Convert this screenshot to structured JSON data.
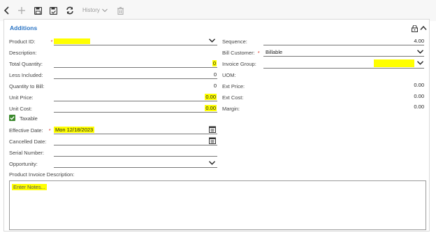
{
  "toolbar": {
    "history_label": "History"
  },
  "section": {
    "title": "Additions"
  },
  "left": {
    "product_id_label": "Product ID:",
    "description_label": "Description:",
    "total_quantity_label": "Total Quantity:",
    "total_quantity_value": "0",
    "less_included_label": "Less Included:",
    "less_included_value": "0",
    "quantity_to_bill_label": "Quantity to Bill:",
    "quantity_to_bill_value": "0",
    "unit_price_label": "Unit Price:",
    "unit_price_value": "0.00",
    "unit_cost_label": "Unit Cost:",
    "unit_cost_value": "0.00",
    "taxable_label": "Taxable",
    "effective_date_label": "Effective Date:",
    "effective_date_value": "Mon 12/18/2023",
    "cancelled_date_label": "Cancelled Date:",
    "serial_number_label": "Serial Number:",
    "opportunity_label": "Opportunity:",
    "product_invoice_description_label": "Product Invoice Description:",
    "notes_placeholder": "Enter Notes..."
  },
  "right": {
    "sequence_label": "Sequence:",
    "sequence_value": "4.00",
    "bill_customer_label": "Bill Customer:",
    "bill_customer_value": "Billable",
    "invoice_group_label": "Invoice Group:",
    "uom_label": "UOM:",
    "ext_price_label": "Ext Price:",
    "ext_price_value": "0.00",
    "ext_cost_label": "Ext Cost:",
    "ext_cost_value": "0.00",
    "margin_label": "Margin:",
    "margin_value": "0.00"
  },
  "required_marker": "*",
  "colors": {
    "highlight": "#ffff00",
    "accent": "#2a74c4",
    "checkbox": "#3c8a2e",
    "required": "#dd3322"
  },
  "icons": [
    "back-icon",
    "add-icon",
    "save-icon",
    "save-close-icon",
    "refresh-icon",
    "chevron-down-icon",
    "delete-icon",
    "lock-icon",
    "collapse-icon",
    "calendar-icon",
    "check-icon"
  ]
}
